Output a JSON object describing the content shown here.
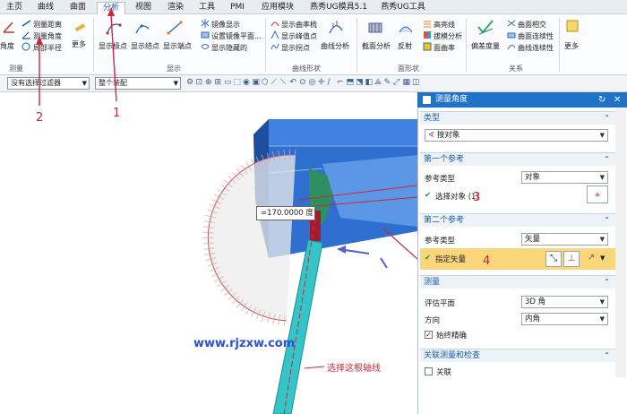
{
  "menu": {
    "tabs": [
      "主页",
      "曲线",
      "曲面",
      "分析",
      "视图",
      "渲染",
      "工具",
      "PMI",
      "应用模块",
      "燕秀UG模具5.1",
      "燕秀UG工具"
    ],
    "active_tab": "分析"
  },
  "ribbon": {
    "measure": {
      "angle_btn": "角度",
      "distance": "测量距离",
      "angle": "测量角度",
      "radius": "局部半径",
      "more": "更多",
      "group": "测量"
    },
    "display": {
      "show_poles": "显示极点",
      "show_nodes": "显示结点",
      "show_knots": "显示端点",
      "mirror": "镜像显示",
      "set_mirror": "设置镜像平面...",
      "hidden": "显示隐藏的",
      "group": "显示"
    },
    "curve_shape": {
      "curvature_comb": "显示曲率梳",
      "peak": "显示峰值点",
      "inflection": "显示拐点",
      "curve_analysis": "曲线分析",
      "group": "曲线形状"
    },
    "face_shape": {
      "section": "截面分析",
      "reflection": "反射",
      "highlight": "高亮线",
      "slope": "拔模分析",
      "face_curvature": "面曲率",
      "group": "面形状"
    },
    "relation": {
      "deviation": "偏差度量",
      "face_intersect": "曲面相交",
      "face_continuity": "曲面连续性",
      "curve_continuity": "曲线连续性",
      "group": "关系"
    },
    "more": "更多"
  },
  "toolbar": {
    "filter": "没有选择过滤器",
    "assembly": "整个装配"
  },
  "viewport": {
    "measure_value": "=170.0000 度",
    "watermark": "www.rjzxw.com",
    "annotation": "选择这根轴线",
    "markers": [
      "1",
      "2",
      "3",
      "4"
    ]
  },
  "dialog": {
    "title": "测量角度",
    "type_section": "类型",
    "type_value": "按对象",
    "ref1_section": "第一个参考",
    "ref1_type_label": "参考类型",
    "ref1_type_value": "对象",
    "select_object": "选择对象 (1)",
    "ref2_section": "第二个参考",
    "ref2_type_label": "参考类型",
    "ref2_type_value": "矢量",
    "specify_vector": "指定矢量",
    "measure_section": "测量",
    "eval_plane_label": "评估平面",
    "eval_plane_value": "3D 角",
    "direction_label": "方向",
    "direction_value": "内角",
    "always_precise": "始终精确",
    "assoc_section": "关联测量和检查",
    "assoc_label": "关联"
  }
}
